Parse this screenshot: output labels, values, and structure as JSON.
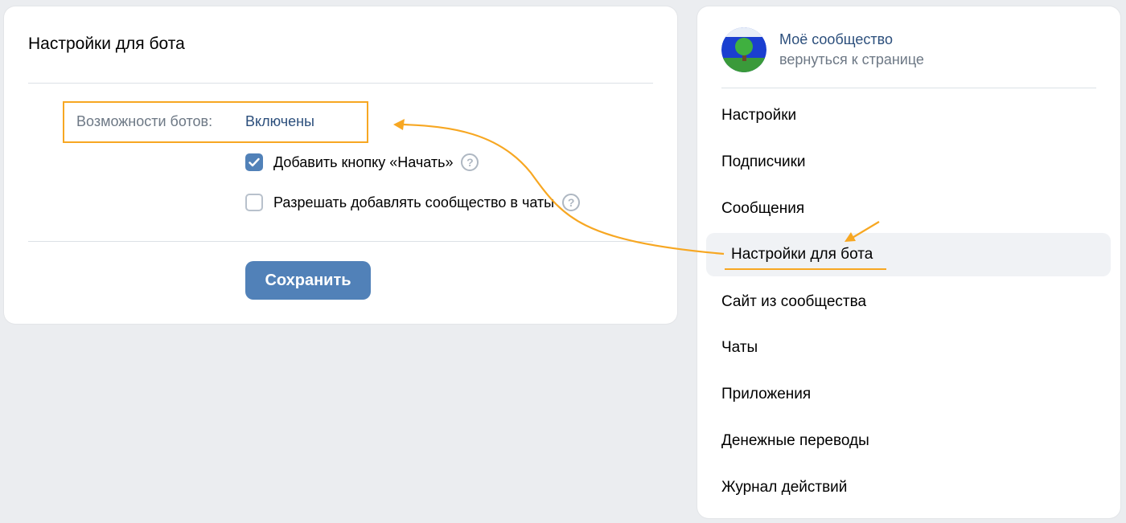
{
  "main": {
    "title": "Настройки для бота",
    "setting": {
      "label": "Возможности ботов:",
      "value": "Включены"
    },
    "checkboxes": [
      {
        "label": "Добавить кнопку «Начать»",
        "checked": true
      },
      {
        "label": "Разрешать добавлять сообщество в чаты",
        "checked": false
      }
    ],
    "help_glyph": "?",
    "save_label": "Сохранить"
  },
  "sidebar": {
    "community_name": "Моё сообщество",
    "back_link": "вернуться к странице",
    "items": [
      {
        "label": "Настройки"
      },
      {
        "label": "Подписчики"
      },
      {
        "label": "Сообщения"
      },
      {
        "label": "Настройки для бота",
        "active": true
      },
      {
        "label": "Сайт из сообщества"
      },
      {
        "label": "Чаты"
      },
      {
        "label": "Приложения"
      },
      {
        "label": "Денежные переводы"
      },
      {
        "label": "Журнал действий"
      }
    ]
  },
  "colors": {
    "accent": "#5181b8",
    "annotation": "#f7a722",
    "link": "#2c4f7c",
    "muted": "#6d7885"
  }
}
